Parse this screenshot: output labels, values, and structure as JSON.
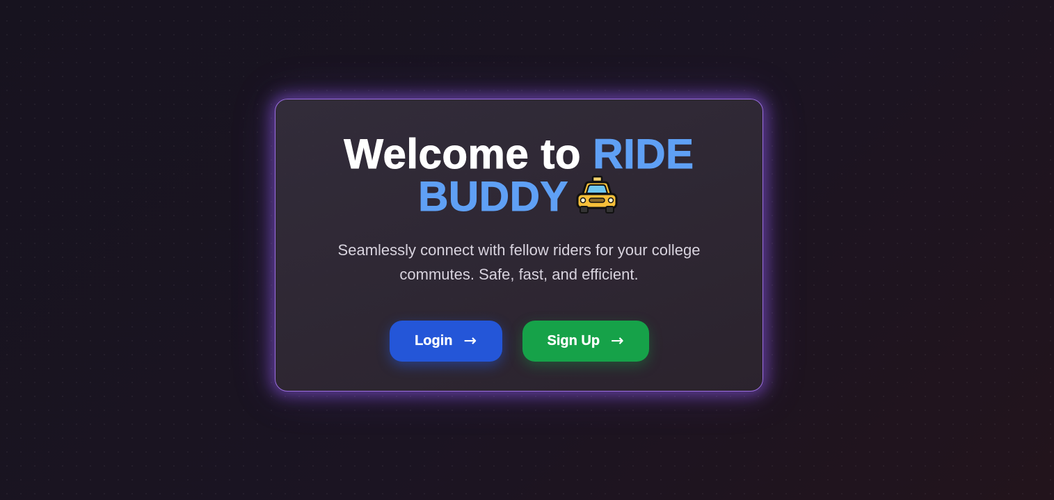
{
  "hero": {
    "title_prefix": "Welcome to ",
    "title_accent": "RIDE BUDDY",
    "title_icon": "taxi-icon",
    "subtitle": "Seamlessly connect with fellow riders for your college commutes. Safe, fast, and efficient."
  },
  "actions": {
    "login_label": "Login",
    "signup_label": "Sign Up",
    "arrow": "→"
  },
  "colors": {
    "background": "#17131f",
    "card_border": "#9b6ee0",
    "accent": "#5fa0f5",
    "login_button": "#2456d8",
    "signup_button": "#16a249"
  }
}
